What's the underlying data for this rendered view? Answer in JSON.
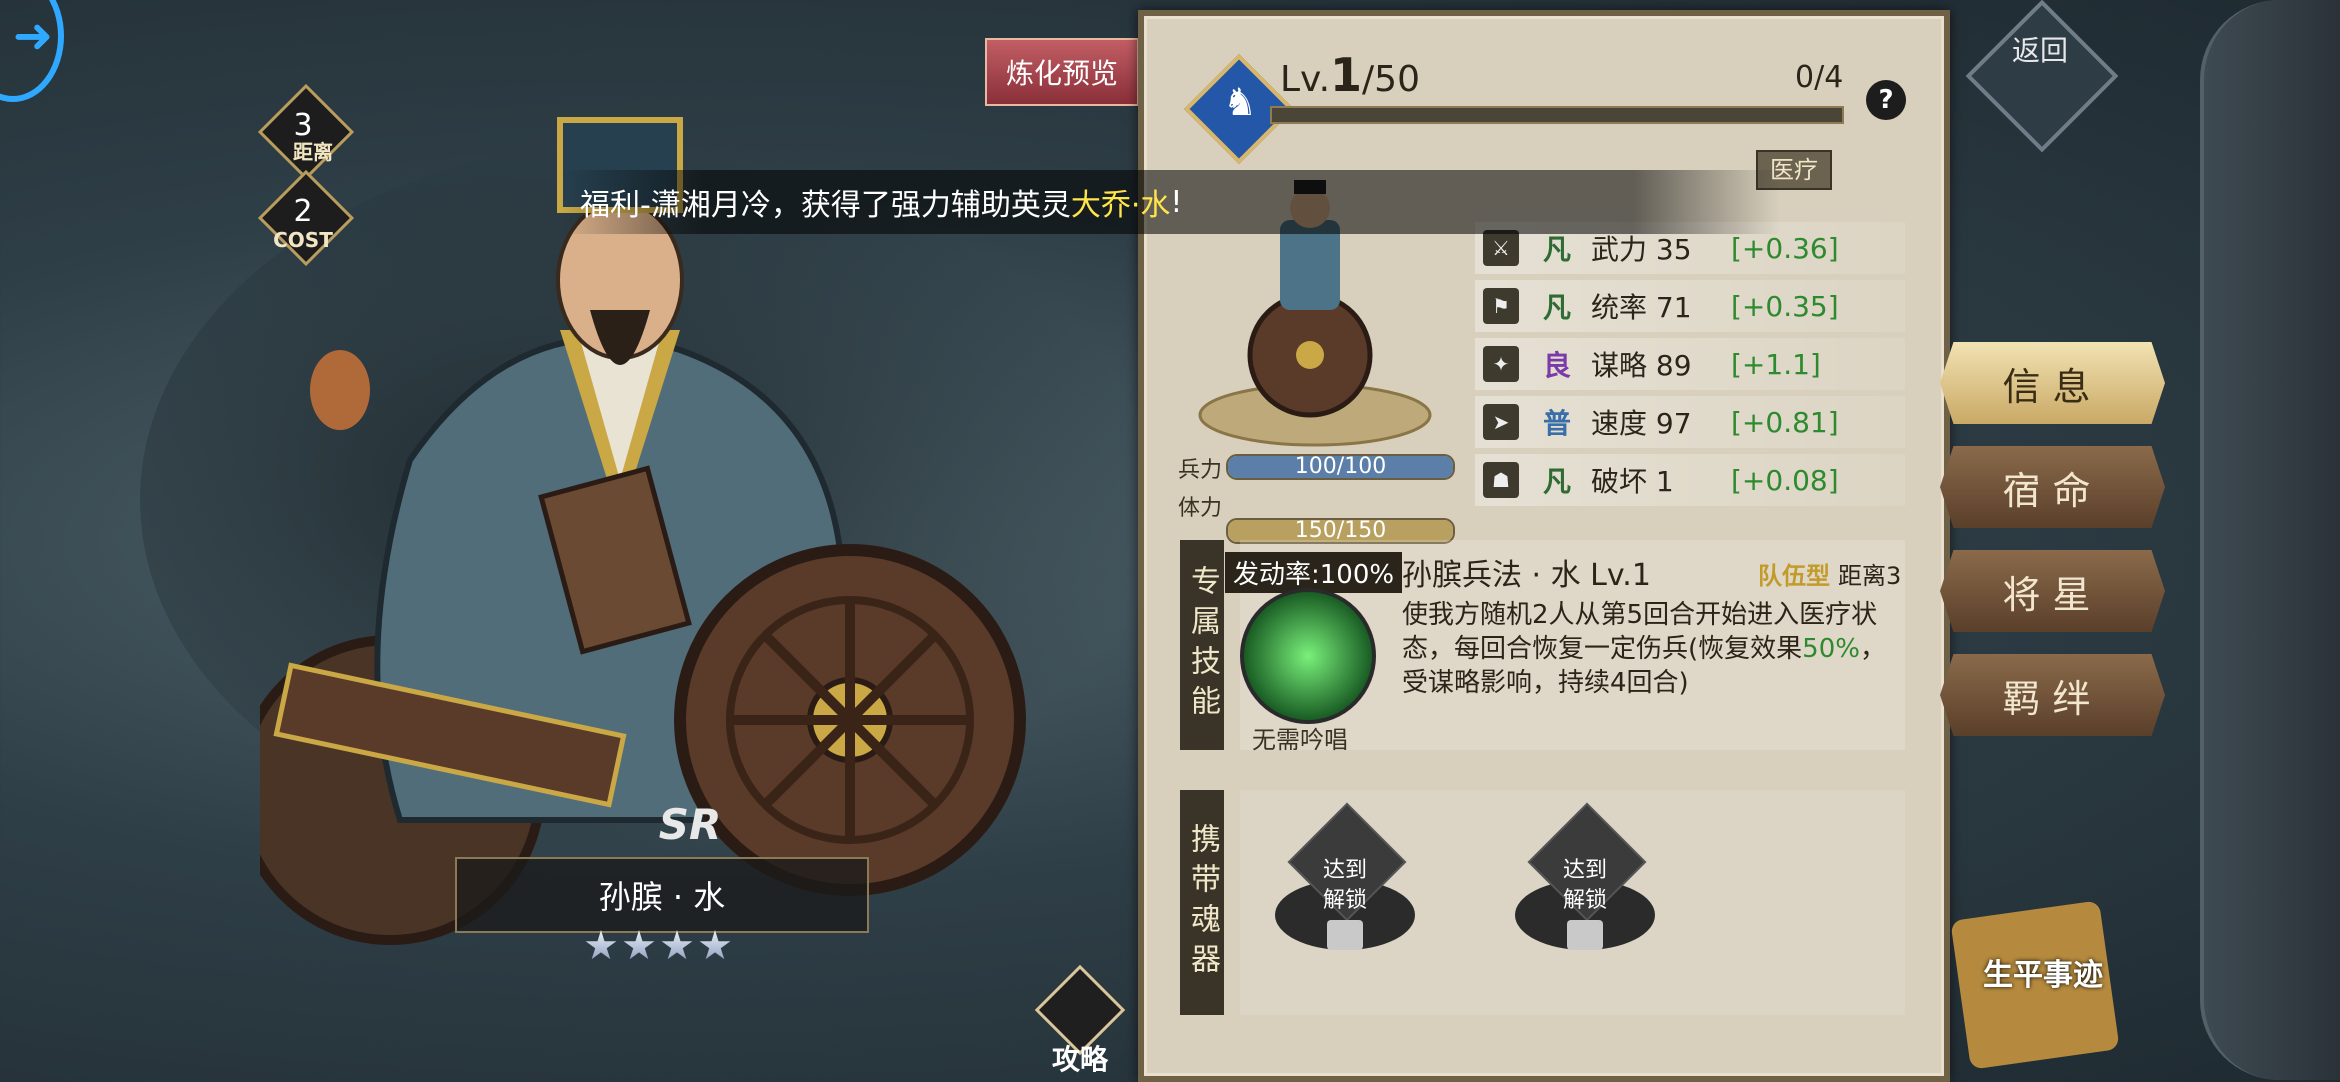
{
  "hud": {
    "distance_value": "3",
    "distance_label": "距离",
    "cost_value": "2",
    "cost_label": "COST",
    "refine_preview": "炼化预览"
  },
  "notice": {
    "prefix": "福利-潇湘月冷，获得了强力辅助英灵",
    "highlight": "大乔·水",
    "suffix": "!"
  },
  "hero": {
    "rarity": "SR",
    "name": "孙膑 · 水",
    "stars": 4,
    "strategy_label": "攻略"
  },
  "level": {
    "prefix": "Lv.",
    "current": "1",
    "max": "/50",
    "progress_text": "0/4",
    "progress_fraction": 0,
    "help": "?",
    "role_tag": "医疗"
  },
  "bars": {
    "troops_label": "兵力",
    "troops_value": "100/100",
    "troops_color": "#5b7fa8",
    "stamina_label": "体力",
    "stamina_value": "150/150",
    "stamina_color": "#b8a061"
  },
  "stats": [
    {
      "icon": "sword-icon",
      "glyph": "⚔",
      "grade": "凡",
      "grade_color": "#2f6b34",
      "name": "武力 35",
      "bonus": "[+0.36]"
    },
    {
      "icon": "flag-icon",
      "glyph": "⚑",
      "grade": "凡",
      "grade_color": "#2f6b34",
      "name": "统率 71",
      "bonus": "[+0.35]"
    },
    {
      "icon": "strategy-icon",
      "glyph": "✦",
      "grade": "良",
      "grade_color": "#7a3aa8",
      "name": "谋略 89",
      "bonus": "[+1.1]"
    },
    {
      "icon": "speed-icon",
      "glyph": "➤",
      "grade": "普",
      "grade_color": "#3a6ea8",
      "name": "速度 97",
      "bonus": "[+0.81]"
    },
    {
      "icon": "destroy-icon",
      "glyph": "☗",
      "grade": "凡",
      "grade_color": "#2f6b34",
      "name": "破坏 1",
      "bonus": "[+0.08]"
    }
  ],
  "skill": {
    "tab_label": "专属技能",
    "rate": "发动率:100%",
    "name": "孙膑兵法 · 水 Lv.1",
    "type": "队伍型",
    "range": "距离3",
    "desc_1": "使我方随机2人从第5回合开始进入医疗状态，每回合恢复一定伤兵(恢复效果",
    "desc_pct": "50%",
    "desc_2": "，受谋略影响，持续4回合)",
    "cast": "无需吟唱"
  },
  "soul": {
    "tab_label": "携带魂器",
    "slot1_reach": "达到",
    "slot1_unlock": "解锁",
    "slot2_reach": "达到",
    "slot2_unlock": "解锁"
  },
  "nav": {
    "return_label": "返回",
    "info": "信息",
    "fate": "宿命",
    "star": "将星",
    "bond": "羁绊",
    "biography": "生平事迹"
  }
}
